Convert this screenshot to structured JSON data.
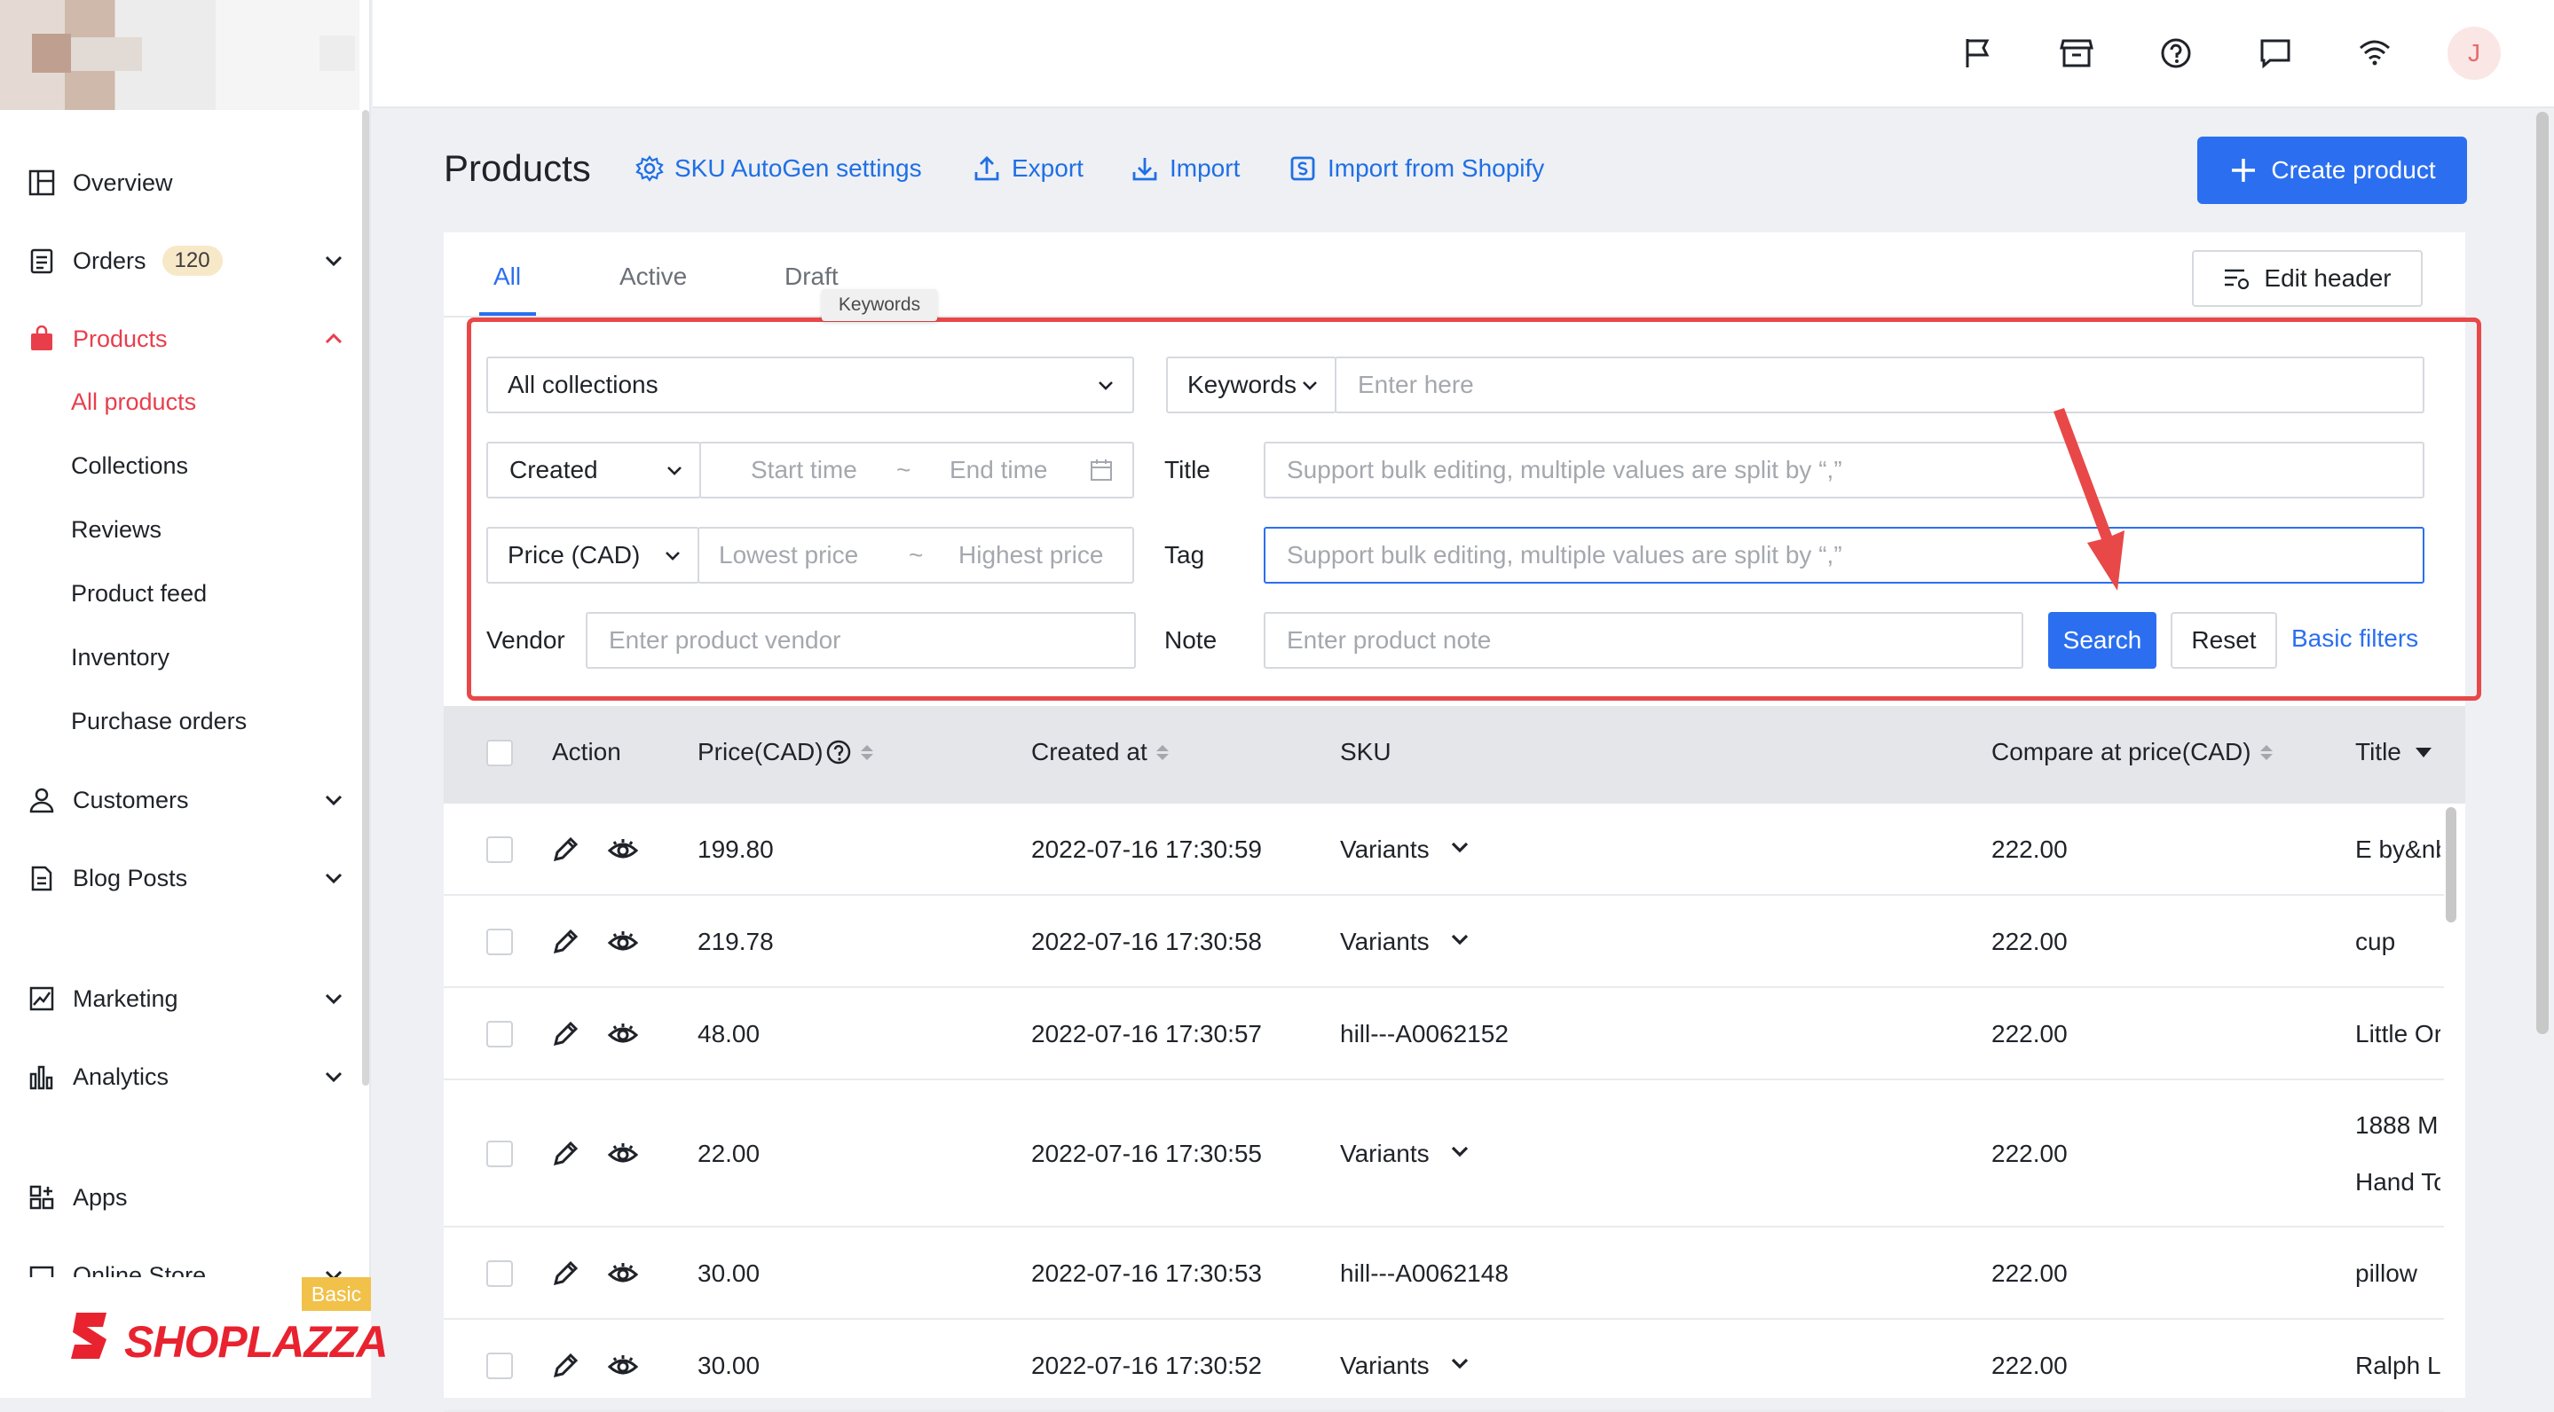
{
  "sidebar": {
    "items": [
      {
        "label": "Overview",
        "icon": "overview-icon"
      },
      {
        "label": "Orders",
        "badge": "120",
        "icon": "orders-icon"
      },
      {
        "label": "Products",
        "icon": "products-bag-icon"
      },
      {
        "label": "Customers",
        "icon": "customers-icon"
      },
      {
        "label": "Blog Posts",
        "icon": "blog-icon"
      },
      {
        "label": "Marketing",
        "icon": "marketing-icon"
      },
      {
        "label": "Analytics",
        "icon": "analytics-icon"
      },
      {
        "label": "Apps",
        "icon": "apps-icon"
      },
      {
        "label": "Online Store",
        "icon": "store-icon"
      }
    ],
    "product_subitems": [
      "All products",
      "Collections",
      "Reviews",
      "Product feed",
      "Inventory",
      "Purchase orders"
    ],
    "brand": "SHOPLAZZA",
    "plan_badge": "Basic"
  },
  "topbar": {
    "avatar_initial": "J",
    "icons": [
      "flag-icon",
      "store-icon",
      "help-icon",
      "chat-icon",
      "wifi-icon"
    ]
  },
  "header": {
    "title": "Products",
    "links": [
      "SKU AutoGen settings",
      "Export",
      "Import",
      "Import from Shopify"
    ],
    "create_label": "Create product"
  },
  "tabs": [
    "All",
    "Active",
    "Draft"
  ],
  "tooltip": "Keywords",
  "edit_header_label": "Edit header",
  "filters": {
    "collection": "All collections",
    "keyword_type": "Keywords",
    "keyword_placeholder": "Enter here",
    "date_type": "Created",
    "start_placeholder": "Start time",
    "end_placeholder": "End time",
    "range_sep": "~",
    "title_label": "Title",
    "title_placeholder": "Support bulk editing, multiple values are split by “,”",
    "price_type": "Price (CAD)",
    "low_placeholder": "Lowest price",
    "high_placeholder": "Highest price",
    "tag_label": "Tag",
    "tag_placeholder": "Support bulk editing, multiple values are split by “,”",
    "vendor_label": "Vendor",
    "vendor_placeholder": "Enter product vendor",
    "note_label": "Note",
    "note_placeholder": "Enter product note",
    "search_label": "Search",
    "reset_label": "Reset",
    "basic_filters_label": "Basic filters"
  },
  "table": {
    "columns": [
      "Action",
      "Price(CAD)",
      "Created at",
      "SKU",
      "Compare at price(CAD)",
      "Title"
    ],
    "rows": [
      {
        "price": "199.80",
        "created": "2022-07-16 17:30:59",
        "sku": "Variants",
        "sku_expand": true,
        "compare": "222.00",
        "title": "E by&nb"
      },
      {
        "price": "219.78",
        "created": "2022-07-16 17:30:58",
        "sku": "Variants",
        "sku_expand": true,
        "compare": "222.00",
        "title": "cup"
      },
      {
        "price": "48.00",
        "created": "2022-07-16 17:30:57",
        "sku": "hill---A0062152",
        "sku_expand": false,
        "compare": "222.00",
        "title": "Little Or"
      },
      {
        "price": "22.00",
        "created": "2022-07-16 17:30:55",
        "sku": "Variants",
        "sku_expand": true,
        "compare": "222.00",
        "title": "1888 M",
        "title2": "Hand To"
      },
      {
        "price": "30.00",
        "created": "2022-07-16 17:30:53",
        "sku": "hill---A0062148",
        "sku_expand": false,
        "compare": "222.00",
        "title": "pillow"
      },
      {
        "price": "30.00",
        "created": "2022-07-16 17:30:52",
        "sku": "Variants",
        "sku_expand": true,
        "compare": "222.00",
        "title": "Ralph L"
      }
    ]
  },
  "colors": {
    "accent": "#2b6ff0",
    "active_nav": "#e83e4c",
    "highlight_box": "#e84848"
  }
}
